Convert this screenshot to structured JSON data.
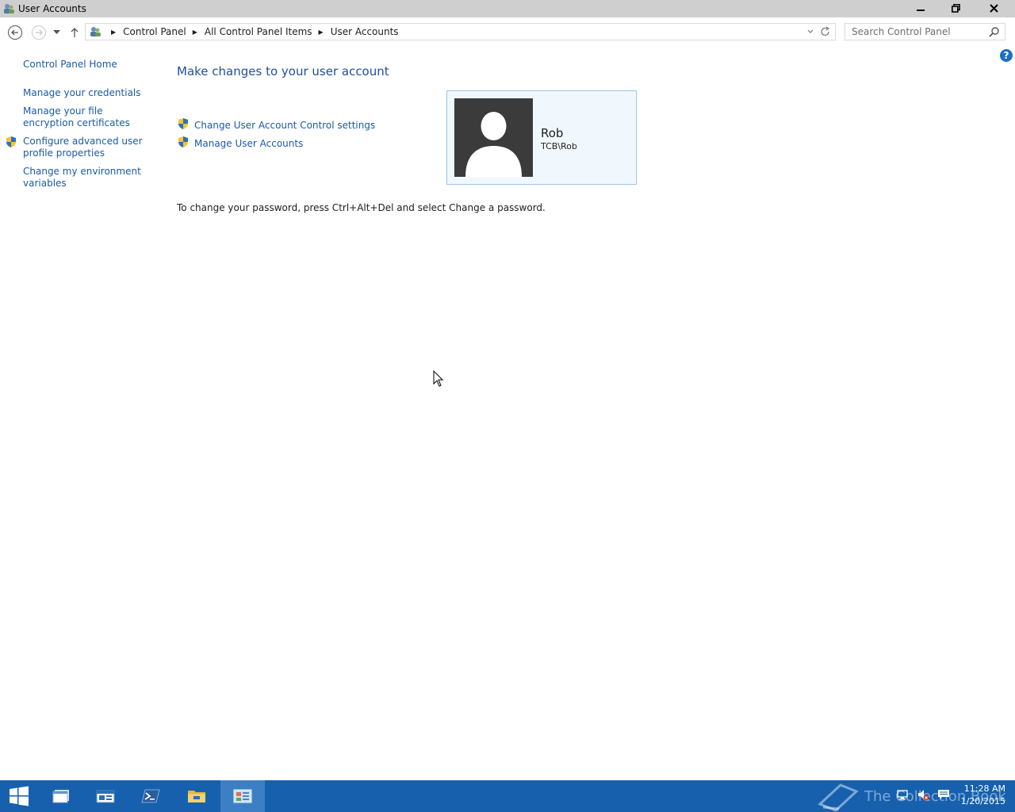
{
  "window": {
    "title": "User Accounts"
  },
  "nav": {
    "breadcrumbs": [
      "Control Panel",
      "All Control Panel Items",
      "User Accounts"
    ],
    "search_placeholder": "Search Control Panel"
  },
  "help": {
    "label": "?"
  },
  "left_pane": {
    "home": "Control Panel Home",
    "links": [
      {
        "label": "Manage your credentials",
        "shield": false
      },
      {
        "label": "Manage your file encryption certificates",
        "shield": false
      },
      {
        "label": "Configure advanced user profile properties",
        "shield": true
      },
      {
        "label": "Change my environment variables",
        "shield": false
      }
    ]
  },
  "main": {
    "heading": "Make changes to your user account",
    "tasks": [
      {
        "label": "Change User Account Control settings",
        "icon": "uac-shield-icon"
      },
      {
        "label": "Manage User Accounts",
        "icon": "uac-shield-icon"
      }
    ],
    "account": {
      "name": "Rob",
      "qualified_name": "TCB\\Rob"
    },
    "password_note": "To change your password, press Ctrl+Alt+Del and select Change a password."
  },
  "taskbar": {
    "apps": [
      "start",
      "file-explorer-window",
      "server-manager",
      "powershell",
      "file-explorer",
      "control-panel"
    ],
    "active_app": "control-panel",
    "watermark": "The Collection Book",
    "clock": {
      "time": "11:28 AM",
      "date": "1/20/2015"
    }
  },
  "colors": {
    "link": "#1b5aa6",
    "heading": "#1f4e9b",
    "taskbar": "#1660ad",
    "card_border": "#99c7ec",
    "card_bg": "#f1f8fd"
  }
}
